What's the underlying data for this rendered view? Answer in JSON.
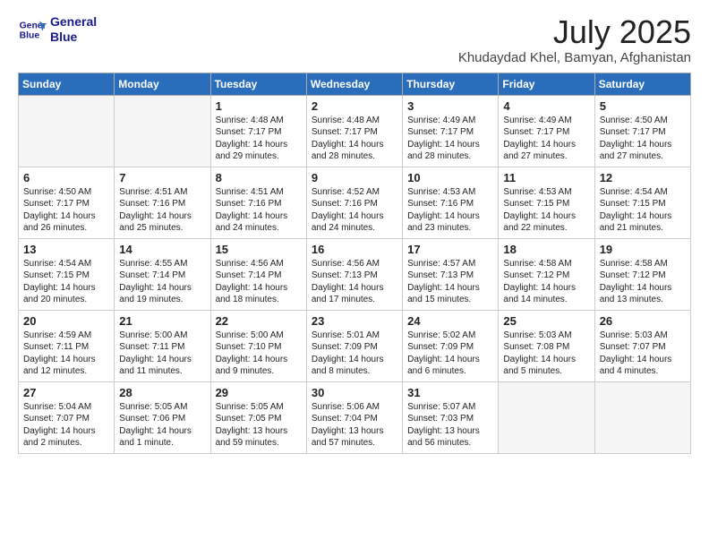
{
  "header": {
    "logo_line1": "General",
    "logo_line2": "Blue",
    "title": "July 2025",
    "subtitle": "Khudaydad Khel, Bamyan, Afghanistan"
  },
  "calendar": {
    "headers": [
      "Sunday",
      "Monday",
      "Tuesday",
      "Wednesday",
      "Thursday",
      "Friday",
      "Saturday"
    ],
    "rows": [
      [
        {
          "day": "",
          "text": ""
        },
        {
          "day": "",
          "text": ""
        },
        {
          "day": "1",
          "text": "Sunrise: 4:48 AM\nSunset: 7:17 PM\nDaylight: 14 hours and 29 minutes."
        },
        {
          "day": "2",
          "text": "Sunrise: 4:48 AM\nSunset: 7:17 PM\nDaylight: 14 hours and 28 minutes."
        },
        {
          "day": "3",
          "text": "Sunrise: 4:49 AM\nSunset: 7:17 PM\nDaylight: 14 hours and 28 minutes."
        },
        {
          "day": "4",
          "text": "Sunrise: 4:49 AM\nSunset: 7:17 PM\nDaylight: 14 hours and 27 minutes."
        },
        {
          "day": "5",
          "text": "Sunrise: 4:50 AM\nSunset: 7:17 PM\nDaylight: 14 hours and 27 minutes."
        }
      ],
      [
        {
          "day": "6",
          "text": "Sunrise: 4:50 AM\nSunset: 7:17 PM\nDaylight: 14 hours and 26 minutes."
        },
        {
          "day": "7",
          "text": "Sunrise: 4:51 AM\nSunset: 7:16 PM\nDaylight: 14 hours and 25 minutes."
        },
        {
          "day": "8",
          "text": "Sunrise: 4:51 AM\nSunset: 7:16 PM\nDaylight: 14 hours and 24 minutes."
        },
        {
          "day": "9",
          "text": "Sunrise: 4:52 AM\nSunset: 7:16 PM\nDaylight: 14 hours and 24 minutes."
        },
        {
          "day": "10",
          "text": "Sunrise: 4:53 AM\nSunset: 7:16 PM\nDaylight: 14 hours and 23 minutes."
        },
        {
          "day": "11",
          "text": "Sunrise: 4:53 AM\nSunset: 7:15 PM\nDaylight: 14 hours and 22 minutes."
        },
        {
          "day": "12",
          "text": "Sunrise: 4:54 AM\nSunset: 7:15 PM\nDaylight: 14 hours and 21 minutes."
        }
      ],
      [
        {
          "day": "13",
          "text": "Sunrise: 4:54 AM\nSunset: 7:15 PM\nDaylight: 14 hours and 20 minutes."
        },
        {
          "day": "14",
          "text": "Sunrise: 4:55 AM\nSunset: 7:14 PM\nDaylight: 14 hours and 19 minutes."
        },
        {
          "day": "15",
          "text": "Sunrise: 4:56 AM\nSunset: 7:14 PM\nDaylight: 14 hours and 18 minutes."
        },
        {
          "day": "16",
          "text": "Sunrise: 4:56 AM\nSunset: 7:13 PM\nDaylight: 14 hours and 17 minutes."
        },
        {
          "day": "17",
          "text": "Sunrise: 4:57 AM\nSunset: 7:13 PM\nDaylight: 14 hours and 15 minutes."
        },
        {
          "day": "18",
          "text": "Sunrise: 4:58 AM\nSunset: 7:12 PM\nDaylight: 14 hours and 14 minutes."
        },
        {
          "day": "19",
          "text": "Sunrise: 4:58 AM\nSunset: 7:12 PM\nDaylight: 14 hours and 13 minutes."
        }
      ],
      [
        {
          "day": "20",
          "text": "Sunrise: 4:59 AM\nSunset: 7:11 PM\nDaylight: 14 hours and 12 minutes."
        },
        {
          "day": "21",
          "text": "Sunrise: 5:00 AM\nSunset: 7:11 PM\nDaylight: 14 hours and 11 minutes."
        },
        {
          "day": "22",
          "text": "Sunrise: 5:00 AM\nSunset: 7:10 PM\nDaylight: 14 hours and 9 minutes."
        },
        {
          "day": "23",
          "text": "Sunrise: 5:01 AM\nSunset: 7:09 PM\nDaylight: 14 hours and 8 minutes."
        },
        {
          "day": "24",
          "text": "Sunrise: 5:02 AM\nSunset: 7:09 PM\nDaylight: 14 hours and 6 minutes."
        },
        {
          "day": "25",
          "text": "Sunrise: 5:03 AM\nSunset: 7:08 PM\nDaylight: 14 hours and 5 minutes."
        },
        {
          "day": "26",
          "text": "Sunrise: 5:03 AM\nSunset: 7:07 PM\nDaylight: 14 hours and 4 minutes."
        }
      ],
      [
        {
          "day": "27",
          "text": "Sunrise: 5:04 AM\nSunset: 7:07 PM\nDaylight: 14 hours and 2 minutes."
        },
        {
          "day": "28",
          "text": "Sunrise: 5:05 AM\nSunset: 7:06 PM\nDaylight: 14 hours and 1 minute."
        },
        {
          "day": "29",
          "text": "Sunrise: 5:05 AM\nSunset: 7:05 PM\nDaylight: 13 hours and 59 minutes."
        },
        {
          "day": "30",
          "text": "Sunrise: 5:06 AM\nSunset: 7:04 PM\nDaylight: 13 hours and 57 minutes."
        },
        {
          "day": "31",
          "text": "Sunrise: 5:07 AM\nSunset: 7:03 PM\nDaylight: 13 hours and 56 minutes."
        },
        {
          "day": "",
          "text": ""
        },
        {
          "day": "",
          "text": ""
        }
      ]
    ]
  }
}
